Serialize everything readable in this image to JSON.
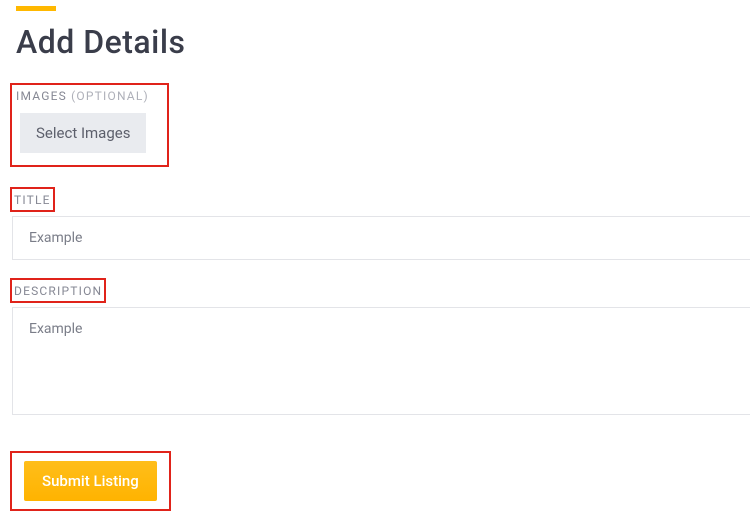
{
  "heading": "Add Details",
  "images": {
    "label": "IMAGES",
    "optional": "(OPTIONAL)",
    "button": "Select Images"
  },
  "title": {
    "label": "TITLE",
    "value": "Example"
  },
  "description": {
    "label": "DESCRIPTION",
    "value": "Example"
  },
  "submit": {
    "label": "Submit Listing"
  }
}
